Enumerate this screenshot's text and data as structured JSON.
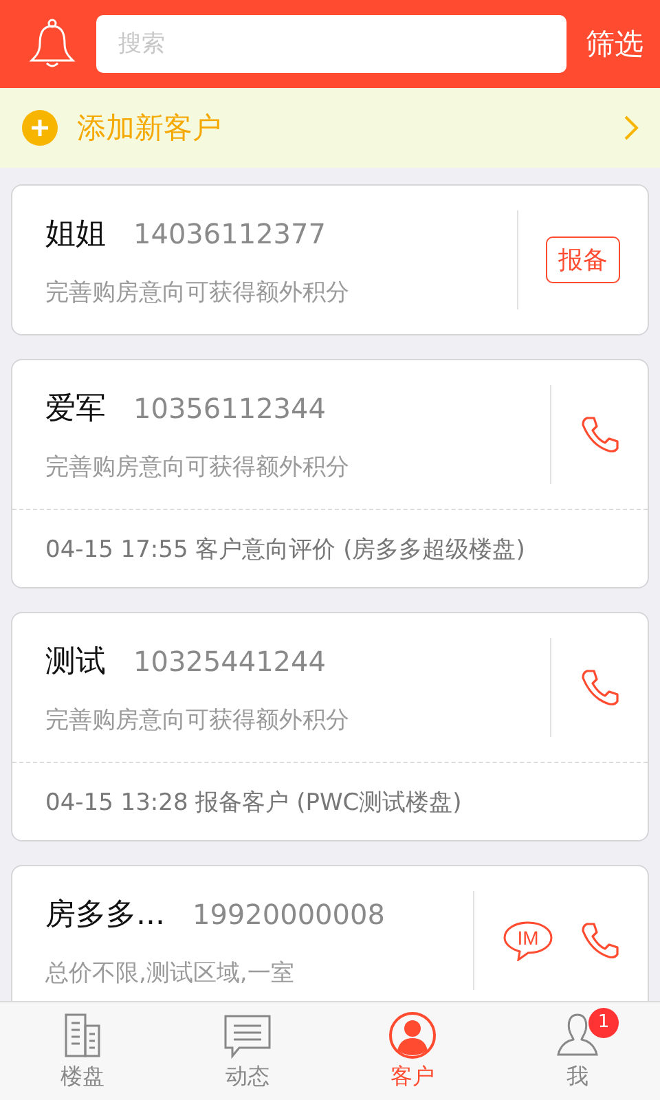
{
  "header": {
    "search": {
      "placeholder": "搜索"
    },
    "filter": "筛选"
  },
  "add_customer": {
    "label": "添加新客户"
  },
  "customers": [
    {
      "name": "姐姐",
      "phone": "14036112377",
      "description": "完善购房意向可获得额外积分",
      "kind": "report",
      "action_label": "报备"
    },
    {
      "name": "爱军",
      "phone": "10356112344",
      "description": "完善购房意向可获得额外积分",
      "kind": "call",
      "note": "04-15 17:55 客户意向评价 (房多多超级楼盘)"
    },
    {
      "name": "测试",
      "phone": "10325441244",
      "description": "完善购房意向可获得额外积分",
      "kind": "call",
      "note": "04-15 13:28 报备客户 (PWC测试楼盘)"
    },
    {
      "name": "房多多...",
      "phone": "19920000008",
      "description": "总价不限,测试区域,一室",
      "kind": "im_call",
      "action_label": "IM"
    }
  ],
  "tabs": [
    {
      "label": "楼盘",
      "kind": "building",
      "selected": false
    },
    {
      "label": "动态",
      "kind": "message",
      "selected": false
    },
    {
      "label": "客户",
      "kind": "person",
      "selected": true
    },
    {
      "label": "我",
      "kind": "user",
      "selected": false,
      "badge": "1"
    }
  ]
}
